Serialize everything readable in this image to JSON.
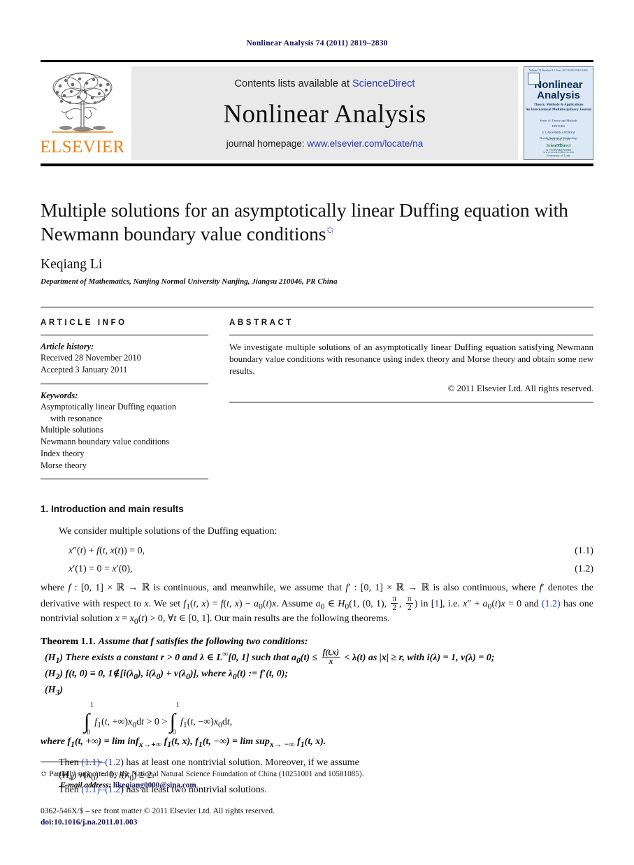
{
  "running_head": "Nonlinear Analysis 74 (2011) 2819–2830",
  "masthead": {
    "publisher_name": "ELSEVIER",
    "contents_prefix": "Contents lists available at ",
    "contents_link": "ScienceDirect",
    "journal_title": "Nonlinear Analysis",
    "homepage_prefix": "journal homepage: ",
    "homepage_link": "www.elsevier.com/locate/na",
    "cover": {
      "topbar": "Volume 74   Number 8   1 June 2011   ISSN 0362-546X",
      "name_line1": "Nonlinear",
      "name_line2": "Analysis",
      "subtitle_line1": "Theory, Methods & Applications",
      "subtitle_line2": "An International Multidisciplinary Journal",
      "block_line1": "Series A: Theory and Methods",
      "block_line2": "EDITORS",
      "block_line3": "V. LAKSHMIKANTHAM",
      "block_line4": "Florida Institute of Technology",
      "block_line5": "and",
      "block_line6": "A. NOWAKOWSKI",
      "block_line7": "University of Lodz",
      "foot_avail": "AVAILABLE ON",
      "foot_sd": "ScienceDirect",
      "foot_url": "www.sciencedirect.com"
    }
  },
  "article": {
    "title": "Multiple solutions for an asymptotically linear Duffing equation with Newmann boundary value conditions",
    "title_marker": "✩",
    "authors": "Keqiang Li",
    "affiliation": "Department of Mathematics, Nanjing Normal University Nanjing, Jiangsu 210046, PR China"
  },
  "article_info": {
    "heading": "ARTICLE INFO",
    "history_label": "Article history:",
    "history_lines": [
      "Received 28 November 2010",
      "Accepted 3 January 2011"
    ],
    "keywords_label": "Keywords:",
    "keywords": [
      "Asymptotically linear Duffing equation",
      "with resonance",
      "Multiple solutions",
      "Newmann boundary value conditions",
      "Index theory",
      "Morse theory"
    ]
  },
  "abstract": {
    "heading": "ABSTRACT",
    "text": "We investigate multiple solutions of an asymptotically linear Duffing equation satisfying Newmann boundary value conditions with resonance using index theory and Morse theory and obtain some new results.",
    "copyright": "© 2011 Elsevier Ltd. All rights reserved."
  },
  "introduction": {
    "section_title": "1. Introduction and main results",
    "lead_paragraph": "We consider multiple solutions of the Duffing equation:",
    "equations": [
      {
        "body": "x″(t) + f(t, x(t)) = 0,",
        "number": "(1.1)"
      },
      {
        "body": "x′(1) = 0 = x′(0),",
        "number": "(1.2)"
      }
    ],
    "after_eq_p1": "where f : [0, 1] × ℝ → ℝ is continuous, and meanwhile, we assume that f′ : [0, 1] × ℝ → ℝ is also continuous, where f′ denotes the derivative with respect to x. We set f₁(t, x) = f(t, x) − a₀(t)x. Assume a₀ ∈ H₀(1, (0, 1), π/2, π/2) in [1], i.e. x″ + a₀(t)x = 0 and (1.2) has one nontrivial solution x = x₀(t) > 0, ∀t ∈ [0, 1]. Our main results are the following theorems.",
    "theorem_label": "Theorem 1.1.",
    "theorem_statement": "Assume that f satisfies the following two conditions:",
    "conditions": [
      "(H₁) There exists a constant r > 0 and λ ∈ L∞[0, 1] such that a₀(t) ≤ f(t,x)/x < λ(t) as |x| ≥ r, with i(λ) = 1, ν(λ) = 0;",
      "(H₂) f(t, 0) ≡ 0, 1∉[i(λ₀), i(λ₀) + ν(λ₀)], where λ₀(t) := f′(t, 0);",
      "(H₃)"
    ],
    "display_equation": "∫₀¹ f₁(t, +∞)x₀dt > 0 > ∫₀¹ f₁(t, −∞)x₀dt,",
    "where_line": "where f₁(t, +∞) = lim inf_{x→+∞} f₁(t, x), f₁(t, −∞) = lim sup_{x→ −∞} f₁(t, x).",
    "then_line_1_pre": "Then ",
    "then_line_1_ref1": "(1.1)",
    "then_line_1_dash": "–(",
    "then_line_1_ref2": "1.2",
    "then_line_1_post": ") has at least one nontrivial solution. Moreover, if we assume",
    "condition_h4": "(H₄) ν(λ₀) = 0, i(λ₀) ≥ 2.",
    "then_line_2_post": ") has at least two nontrivial solutions."
  },
  "footnotes": {
    "funding_marker": "✩",
    "funding": "Partially supported by the National Natural Science Foundation of China (10251001 and 10581085).",
    "email_label": "E-mail address:",
    "email": "likeqiang0000@sina.com",
    "email_suffix": ".",
    "issn_line": "0362-546X/$ – see front matter © 2011 Elsevier Ltd. All rights reserved.",
    "doi_line": "doi:10.1016/j.na.2011.01.003"
  },
  "colors": {
    "link_blue": "#2b3fb0",
    "navy": "#12135e",
    "elsevier_orange": "#f08010",
    "masthead_grey": "#e9e9e9"
  }
}
